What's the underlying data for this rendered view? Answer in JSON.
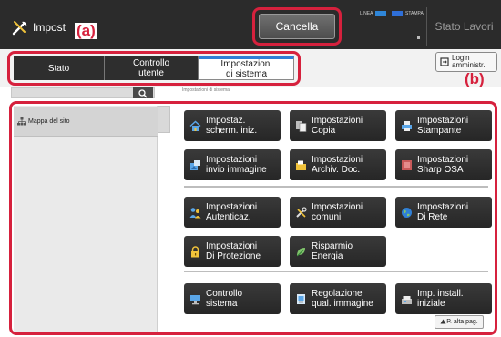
{
  "header": {
    "app_title": "Impost",
    "cancel_label": "Cancella",
    "status_indicators": [
      {
        "label": "LINEA",
        "color": "#2f86d8"
      },
      {
        "label": "STAMPA",
        "color": "#2f6fd8"
      }
    ],
    "job_status_label": "Stato Lavori"
  },
  "callouts": {
    "a": "(a)",
    "b": "(b)"
  },
  "tabs": [
    {
      "label": "Stato"
    },
    {
      "label": "Controllo\nutente"
    },
    {
      "label": "Impostazioni\ndi sistema",
      "selected": true
    }
  ],
  "login": {
    "label": "Login\namministr."
  },
  "breadcrumb": {
    "text": "Impostazioni di sistema"
  },
  "sidebar": {
    "item_label": "Mappa del sito",
    "icon": "sitemap-icon"
  },
  "tiles": [
    {
      "label": "Impostaz.\nscherm. iniz.",
      "icon": "home-icon"
    },
    {
      "label": "Impostazioni\nCopia",
      "icon": "copy-icon"
    },
    {
      "label": "Impostazioni\nStampante",
      "icon": "printer-icon"
    },
    {
      "label": "Impostazioni\ninvio immagine",
      "icon": "send-image-icon"
    },
    {
      "label": "Impostazioni\nArchiv. Doc.",
      "icon": "folder-icon"
    },
    {
      "label": "Impostazioni\nSharp OSA",
      "icon": "osa-icon"
    },
    {
      "label": "Impostazioni\nAutenticaz.",
      "icon": "users-icon"
    },
    {
      "label": "Impostazioni\ncomuni",
      "icon": "tools-icon"
    },
    {
      "label": "Impostazioni\nDi Rete",
      "icon": "globe-icon"
    },
    {
      "label": "Impostazioni\nDi Protezione",
      "icon": "lock-icon"
    },
    {
      "label": "Risparmio\nEnergia",
      "icon": "leaf-icon"
    },
    {
      "label": "Controllo\nsistema",
      "icon": "monitor-icon"
    },
    {
      "label": "Regolazione\nqual. immagine",
      "icon": "image-quality-icon"
    },
    {
      "label": "Imp. install.\niniziale",
      "icon": "install-icon"
    }
  ],
  "page_up": {
    "label": "P. alta pag."
  },
  "colors": {
    "accent_red": "#d6213d",
    "tab_active_blue": "#2f7fd6",
    "tile_dark": "#2e2e2e"
  }
}
